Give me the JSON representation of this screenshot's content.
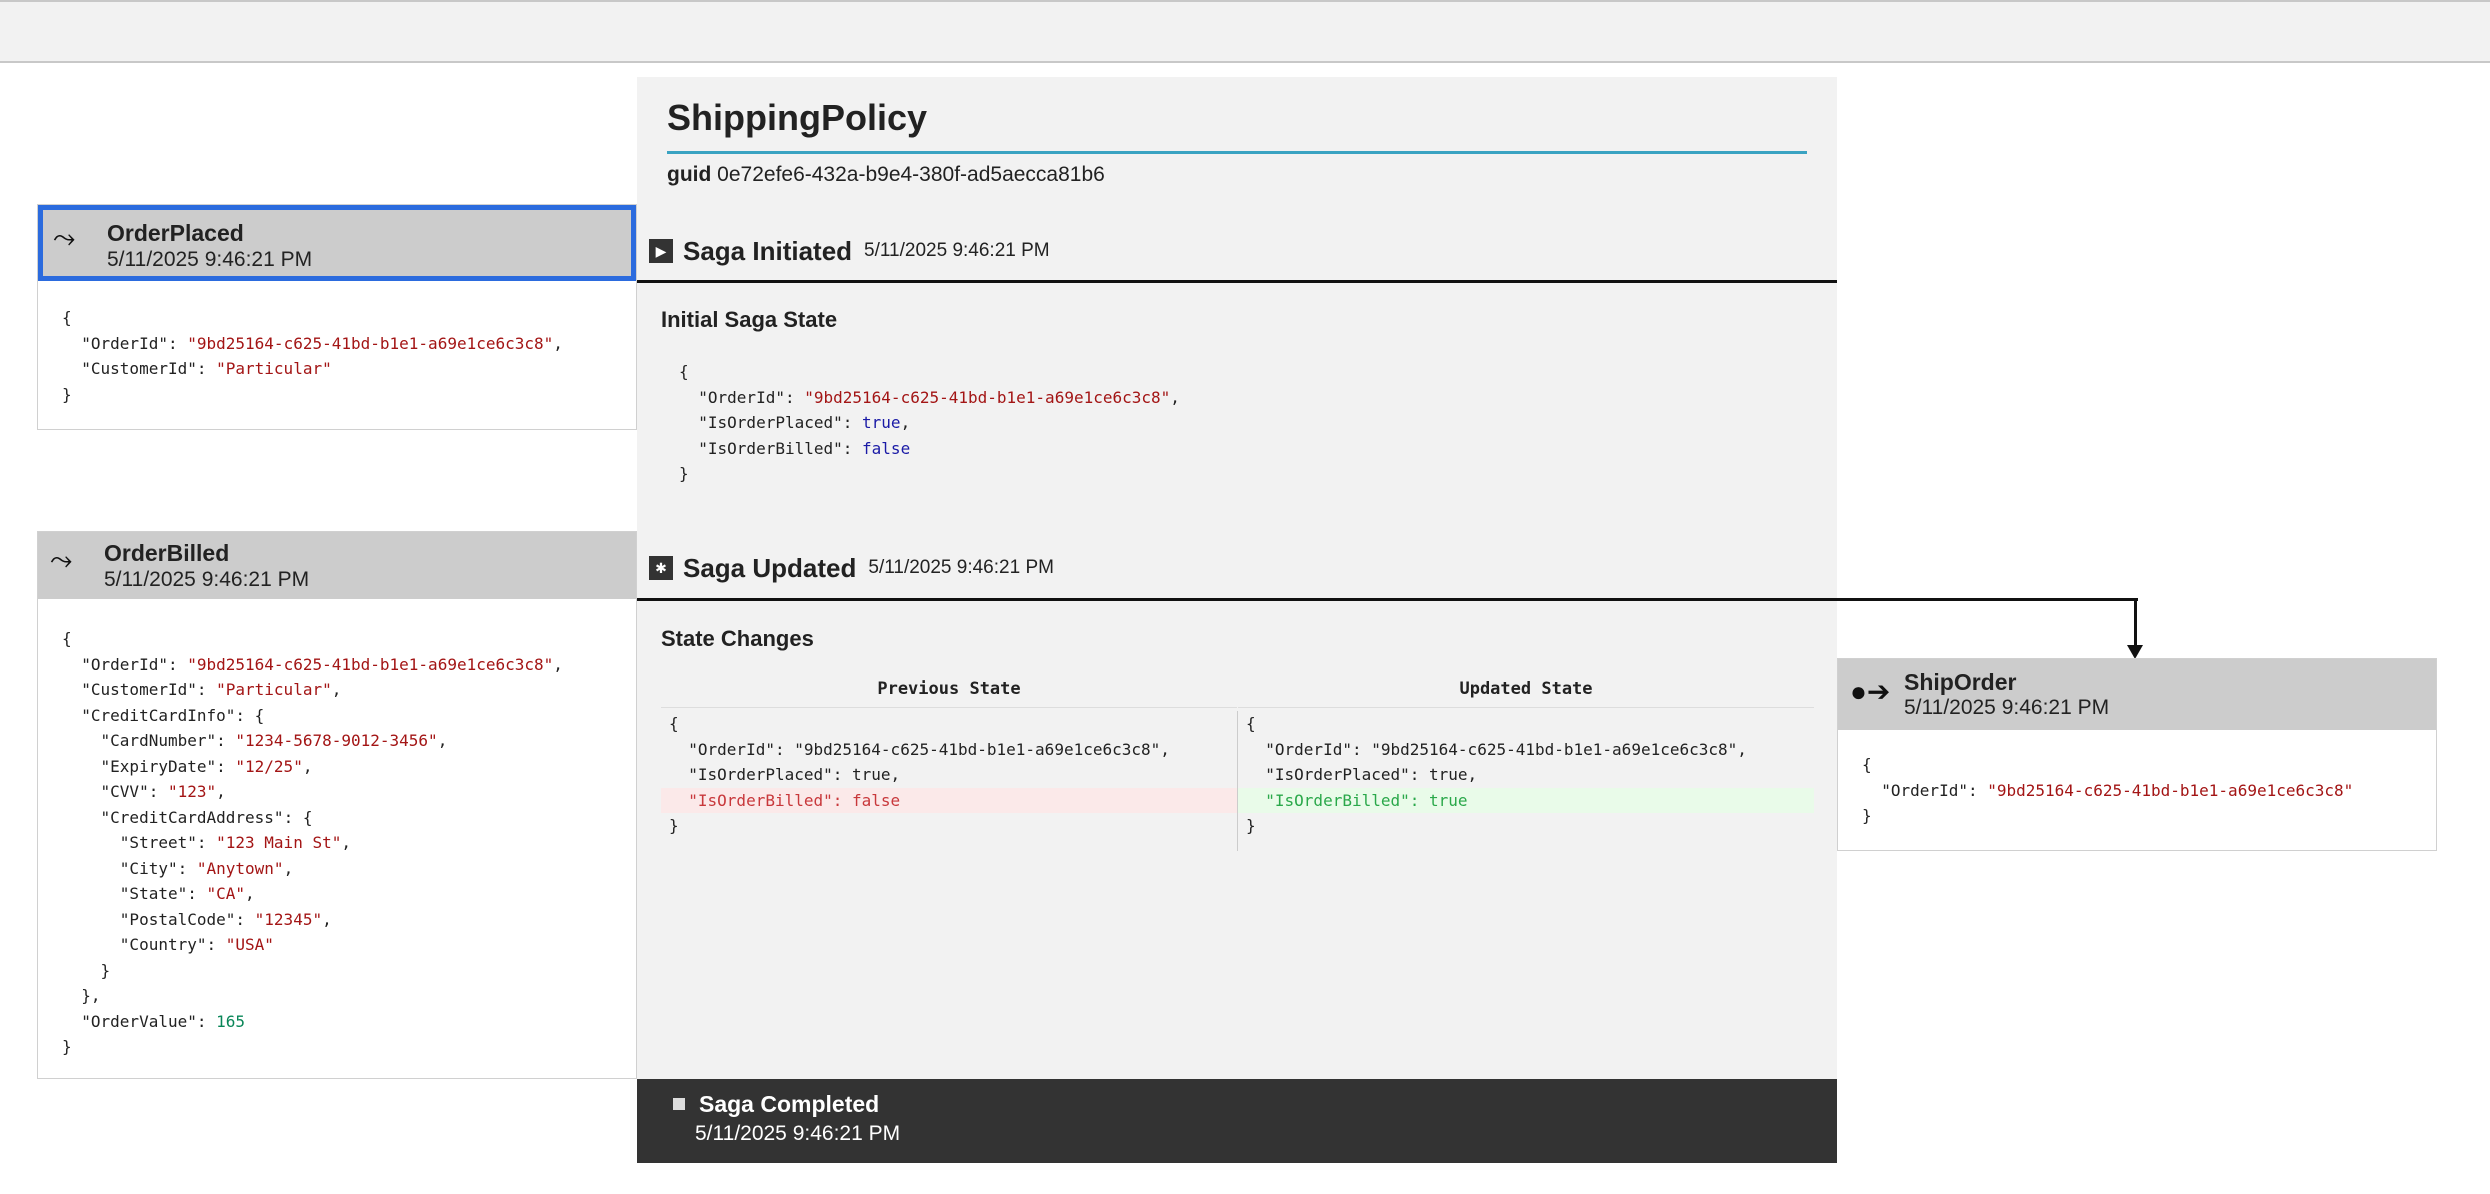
{
  "saga": {
    "title": "ShippingPolicy",
    "guid_label": "guid",
    "guid_value": "0e72efe6-432a-b9e4-380f-ad5aecca81b6",
    "initiated": {
      "title": "Saga Initiated",
      "time": "5/11/2025 9:46:21 PM",
      "icon": "play-icon"
    },
    "initial_state_title": "Initial Saga State",
    "initial_state": {
      "open": "{",
      "l1k": "\"OrderId\"",
      "l1v": "\"9bd25164-c625-41bd-b1e1-a69e1ce6c3c8\"",
      "l2k": "\"IsOrderPlaced\"",
      "l2v": "true",
      "l3k": "\"IsOrderBilled\"",
      "l3v": "false",
      "close": "}"
    },
    "updated": {
      "title": "Saga Updated",
      "time": "5/11/2025 9:46:21 PM",
      "icon": "asterisk-icon"
    },
    "state_changes_title": "State Changes",
    "previous": {
      "header": "Previous State",
      "lines": [
        "{",
        "  \"OrderId\": \"9bd25164-c625-41bd-b1e1-a69e1ce6c3c8\",",
        "  \"IsOrderPlaced\": true,",
        "  \"IsOrderBilled\": false",
        "}"
      ]
    },
    "updated_state": {
      "header": "Updated State",
      "lines": [
        "{",
        "  \"OrderId\": \"9bd25164-c625-41bd-b1e1-a69e1ce6c3c8\",",
        "  \"IsOrderPlaced\": true,",
        "  \"IsOrderBilled\": true",
        "}"
      ]
    },
    "completed": {
      "title": "Saga Completed",
      "time": "5/11/2025 9:46:21 PM"
    }
  },
  "order_placed": {
    "title": "OrderPlaced",
    "time": "5/11/2025 9:46:21 PM",
    "json": {
      "open": "{",
      "l1k": "\"OrderId\"",
      "l1v": "\"9bd25164-c625-41bd-b1e1-a69e1ce6c3c8\"",
      "l2k": "\"CustomerId\"",
      "l2v": "\"Particular\"",
      "close": "}"
    }
  },
  "order_billed": {
    "title": "OrderBilled",
    "time": "5/11/2025 9:46:21 PM",
    "json": {
      "open": "{",
      "order_id_k": "\"OrderId\"",
      "order_id_v": "\"9bd25164-c625-41bd-b1e1-a69e1ce6c3c8\"",
      "customer_k": "\"CustomerId\"",
      "customer_v": "\"Particular\"",
      "cc_k": "\"CreditCardInfo\"",
      "card_k": "\"CardNumber\"",
      "card_v": "\"1234-5678-9012-3456\"",
      "exp_k": "\"ExpiryDate\"",
      "exp_v": "\"12/25\"",
      "cvv_k": "\"CVV\"",
      "cvv_v": "\"123\"",
      "addr_k": "\"CreditCardAddress\"",
      "street_k": "\"Street\"",
      "street_v": "\"123 Main St\"",
      "city_k": "\"City\"",
      "city_v": "\"Anytown\"",
      "state_k": "\"State\"",
      "state_v": "\"CA\"",
      "postal_k": "\"PostalCode\"",
      "postal_v": "\"12345\"",
      "country_k": "\"Country\"",
      "country_v": "\"USA\"",
      "value_k": "\"OrderValue\"",
      "value_v": "165",
      "close": "}"
    }
  },
  "ship_order": {
    "title": "ShipOrder",
    "time": "5/11/2025 9:46:21 PM",
    "json": {
      "open": "{",
      "l1k": "\"OrderId\"",
      "l1v": "\"9bd25164-c625-41bd-b1e1-a69e1ce6c3c8\"",
      "close": "}"
    }
  },
  "colors": {
    "accent_rule": "#3aa3c2",
    "selected_border": "#2b6bde",
    "string": "#a31515",
    "bool": "#1a1aa6",
    "number": "#098658"
  }
}
